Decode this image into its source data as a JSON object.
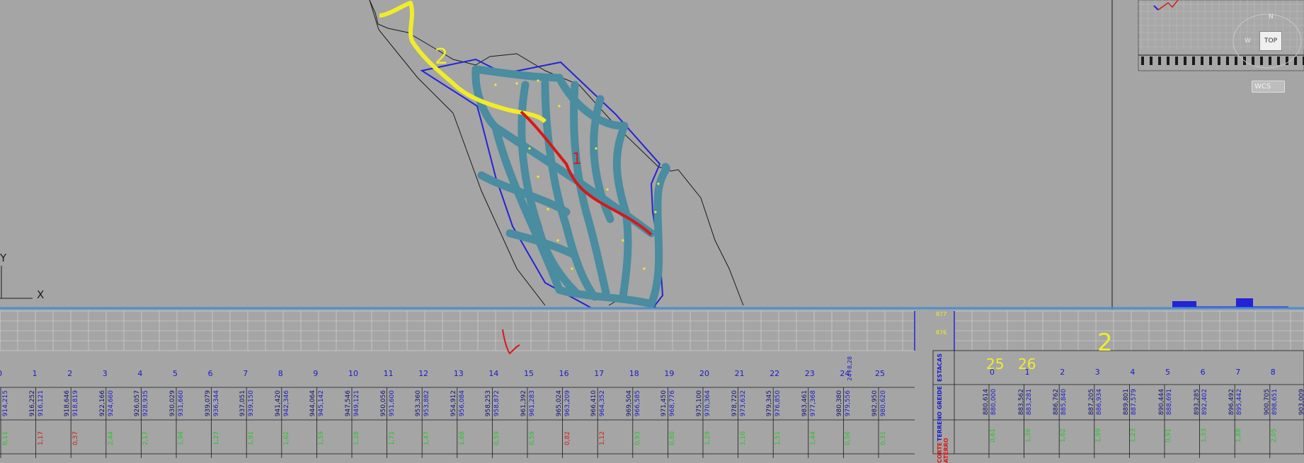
{
  "viewport": {
    "ucs_y": "Y",
    "ucs_x": "X"
  },
  "navcube": {
    "top_label": "TOP",
    "north": "N",
    "west": "W",
    "wcs_label": "WCS"
  },
  "annotations": {
    "plan_route_2": "2",
    "plan_route_1": "1",
    "profile1_tag": "1",
    "profile2_tag": "2",
    "profile2_hand_25": "25",
    "profile2_hand_26": "26"
  },
  "profile1": {
    "stations": [
      "0",
      "1",
      "2",
      "3",
      "4",
      "5",
      "6",
      "7",
      "8",
      "9",
      "10",
      "11",
      "12",
      "13",
      "14",
      "15",
      "16",
      "17",
      "18",
      "19",
      "20",
      "21",
      "22",
      "23",
      "24",
      "25"
    ],
    "station_extra": "24+8,28",
    "greide": [
      "914,215",
      "916,121",
      "918,819",
      "924,660",
      "928,935",
      "931,660",
      "936,344",
      "939,150",
      "942,346",
      "945,142",
      "949,121",
      "951,600",
      "953,882",
      "956,084",
      "958,872",
      "961,283",
      "963,209",
      "964,352",
      "966,585",
      "968,776",
      "970,364",
      "973,632",
      "976,850",
      "977,368",
      "979,556",
      "980,620"
    ],
    "terreno": [
      "",
      "916,252",
      "918,646",
      "922,166",
      "926,057",
      "930,029",
      "939,079",
      "937,051",
      "941,420",
      "944,064",
      "947,546",
      "950,056",
      "953,360",
      "954,912",
      "958,253",
      "961,392",
      "965,024",
      "966,410",
      "969,504",
      "971,450",
      "975,100",
      "978,720",
      "979,345",
      "983,461",
      "980,380",
      "982,950"
    ],
    "cut_fill": [
      "0,11",
      "1,17",
      "0,37",
      "2,44",
      "2,17",
      "1,94",
      "1,27",
      "1,91",
      "1,02",
      "1,59",
      "1,28",
      "1,71",
      "1,47",
      "1,68",
      "0,59",
      "0,59",
      "0,82",
      "1,12",
      "0,93",
      "0,80",
      "1,29",
      "1,10",
      "1,51",
      "1,44",
      "0,56",
      "0,31"
    ]
  },
  "profile2": {
    "axis_top": "877",
    "axis_bottom": "876",
    "row_labels": [
      "ESTACAS",
      "TERRENO GREIDE",
      "CORTE ATERRO"
    ],
    "stations": [
      "0",
      "1",
      "2",
      "3",
      "4",
      "5",
      "6",
      "7",
      "8"
    ],
    "terreno": [
      "880,614",
      "883,562",
      "886,762",
      "887,205",
      "889,801",
      "890,444",
      "893,285",
      "896,492",
      "900,705",
      "903,009"
    ],
    "greide": [
      "880,000",
      "883,281",
      "885,840",
      "886,934",
      "887,579",
      "888,691",
      "892,402",
      "895,442",
      "898,651"
    ],
    "cut_fill": [
      "0,61",
      "1,36",
      "1,62",
      "1,99",
      "1,23",
      "0,91",
      "1,33",
      "1,88",
      "2,05"
    ]
  }
}
